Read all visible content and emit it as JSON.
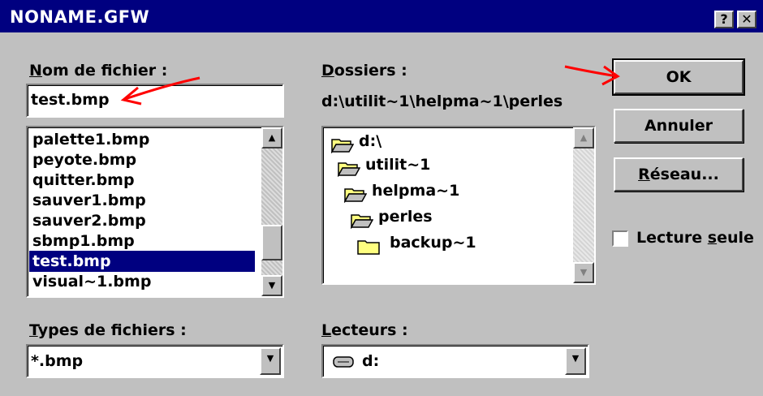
{
  "window": {
    "title": "NONAME.GFW",
    "help_label": "?",
    "close_label": "✕"
  },
  "filename": {
    "label_access": "N",
    "label_rest": "om de fichier :",
    "value": "test.bmp",
    "files": [
      "palette1.bmp",
      "peyote.bmp",
      "quitter.bmp",
      "sauver1.bmp",
      "sauver2.bmp",
      "sbmp1.bmp",
      "test.bmp",
      "visual~1.bmp"
    ],
    "selected_index": 6
  },
  "folders": {
    "label_access": "D",
    "label_rest": "ossiers :",
    "path": "d:\\utilit~1\\helpma~1\\perles",
    "items": [
      "d:\\",
      "utilit~1",
      "helpma~1",
      "perles",
      "backup~1"
    ]
  },
  "filetypes": {
    "label_access": "T",
    "label_rest": "ypes de fichiers :",
    "value": "*.bmp"
  },
  "drives": {
    "label_access": "L",
    "label_rest": "ecteurs :",
    "value": "d:"
  },
  "buttons": {
    "ok": "OK",
    "cancel": "Annuler",
    "network_access": "R",
    "network_rest": "éseau..."
  },
  "readonly": {
    "label_pre": "Lecture ",
    "label_access": "s",
    "label_post": "eule",
    "checked": false
  },
  "colors": {
    "title_bar": "#000080",
    "selection": "#000080",
    "annotation_arrow": "#ff0000",
    "folder": "#ffff80"
  }
}
